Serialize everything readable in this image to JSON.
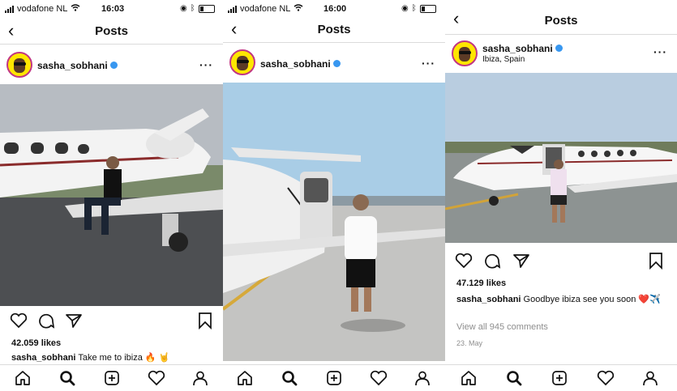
{
  "panels": [
    {
      "status": {
        "carrier": "vodafone NL",
        "time": "16:03"
      },
      "nav_title": "Posts",
      "username": "sasha_sobhani",
      "location": "",
      "likes": "42.059 likes",
      "caption_user": "sasha_sobhani",
      "caption_text": "Take me to ibiza 🔥 🤘",
      "comments": "",
      "date": ""
    },
    {
      "status": {
        "carrier": "vodafone NL",
        "time": "16:00"
      },
      "nav_title": "Posts",
      "username": "sasha_sobhani",
      "location": "",
      "likes": "",
      "caption_user": "",
      "caption_text": "",
      "comments": "",
      "date": ""
    },
    {
      "status": {
        "carrier": "",
        "time": ""
      },
      "nav_title": "Posts",
      "username": "sasha_sobhani",
      "location": "Ibiza, Spain",
      "likes": "47.129 likes",
      "caption_user": "sasha_sobhani",
      "caption_text": "Goodbye ibiza see you soon ❤️✈️",
      "comments": "View all 945 comments",
      "date": "23. May"
    }
  ],
  "icons": {
    "back": "chevron-left-icon",
    "more": "more-horizontal-icon",
    "like": "heart-icon",
    "comment": "comment-icon",
    "share": "send-icon",
    "save": "bookmark-icon",
    "tabs": [
      "home-icon",
      "search-icon",
      "add-icon",
      "activity-heart-icon",
      "profile-icon"
    ]
  },
  "colors": {
    "verified": "#3897f0",
    "avatar_bg": "#ffe600",
    "text_muted": "#8e8e8e"
  }
}
